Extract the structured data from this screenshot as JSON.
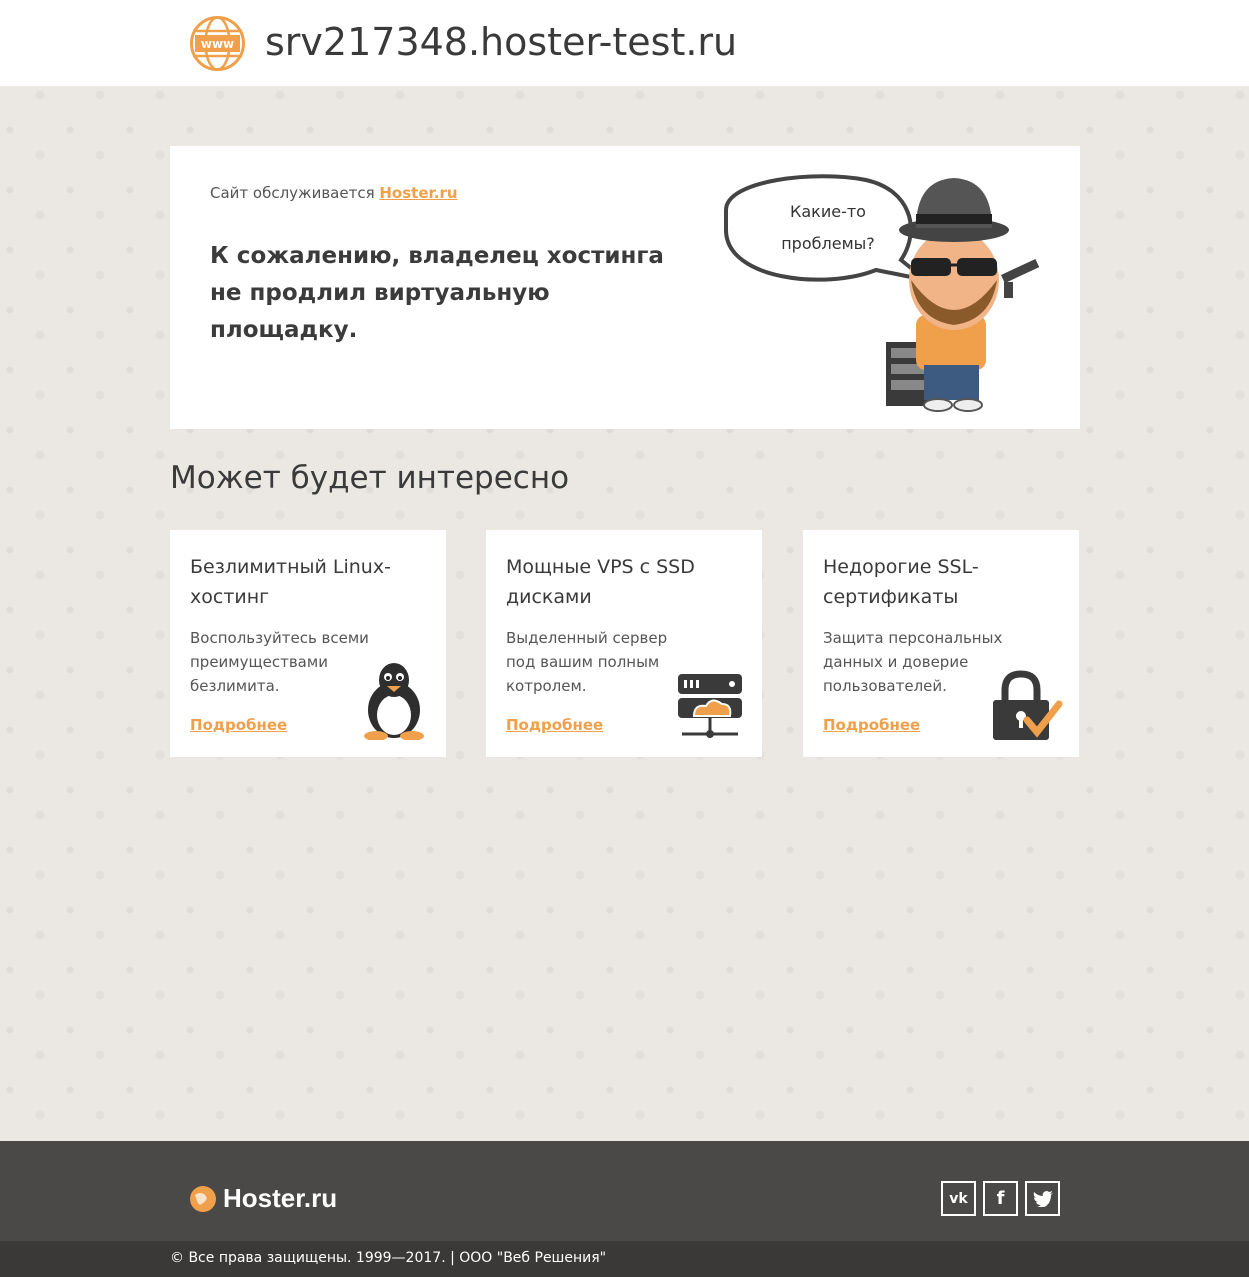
{
  "header": {
    "domain": "srv217348.hoster-test.ru",
    "globe_icon_label": "www"
  },
  "hero": {
    "served_by_prefix": "Сайт обслуживается",
    "served_by_link": "Hoster.ru",
    "headline": "К сожалению, владелец хостинга не продлил виртуальную площадку.",
    "bubble_text": "Какие-то проблемы?"
  },
  "section": {
    "title": "Может будет интересно"
  },
  "cards": [
    {
      "title": "Безлимитный Linux-хостинг",
      "text": "Воспользуйтесь всеми преимуществами безлимита.",
      "link": "Подробнее",
      "icon": "linux-penguin-icon"
    },
    {
      "title": "Мощные VPS с SSD дисками",
      "text": "Выделенный сервер под вашим полным котролем.",
      "link": "Подробнее",
      "icon": "server-cloud-icon"
    },
    {
      "title": "Недорогие SSL-сертификаты",
      "text": "Защита персональных данных и доверие пользователей.",
      "link": "Подробнее",
      "icon": "padlock-check-icon"
    }
  ],
  "footer": {
    "brand": "Hoster.ru",
    "social": [
      "vk",
      "f",
      "twitter"
    ],
    "copyright": "© Все права защищены. 1999—2017. | ООО \"Веб Решения\""
  },
  "colors": {
    "accent": "#f0a04b",
    "footer_bg": "#4a4948",
    "copyright_bg": "#3a3938"
  }
}
